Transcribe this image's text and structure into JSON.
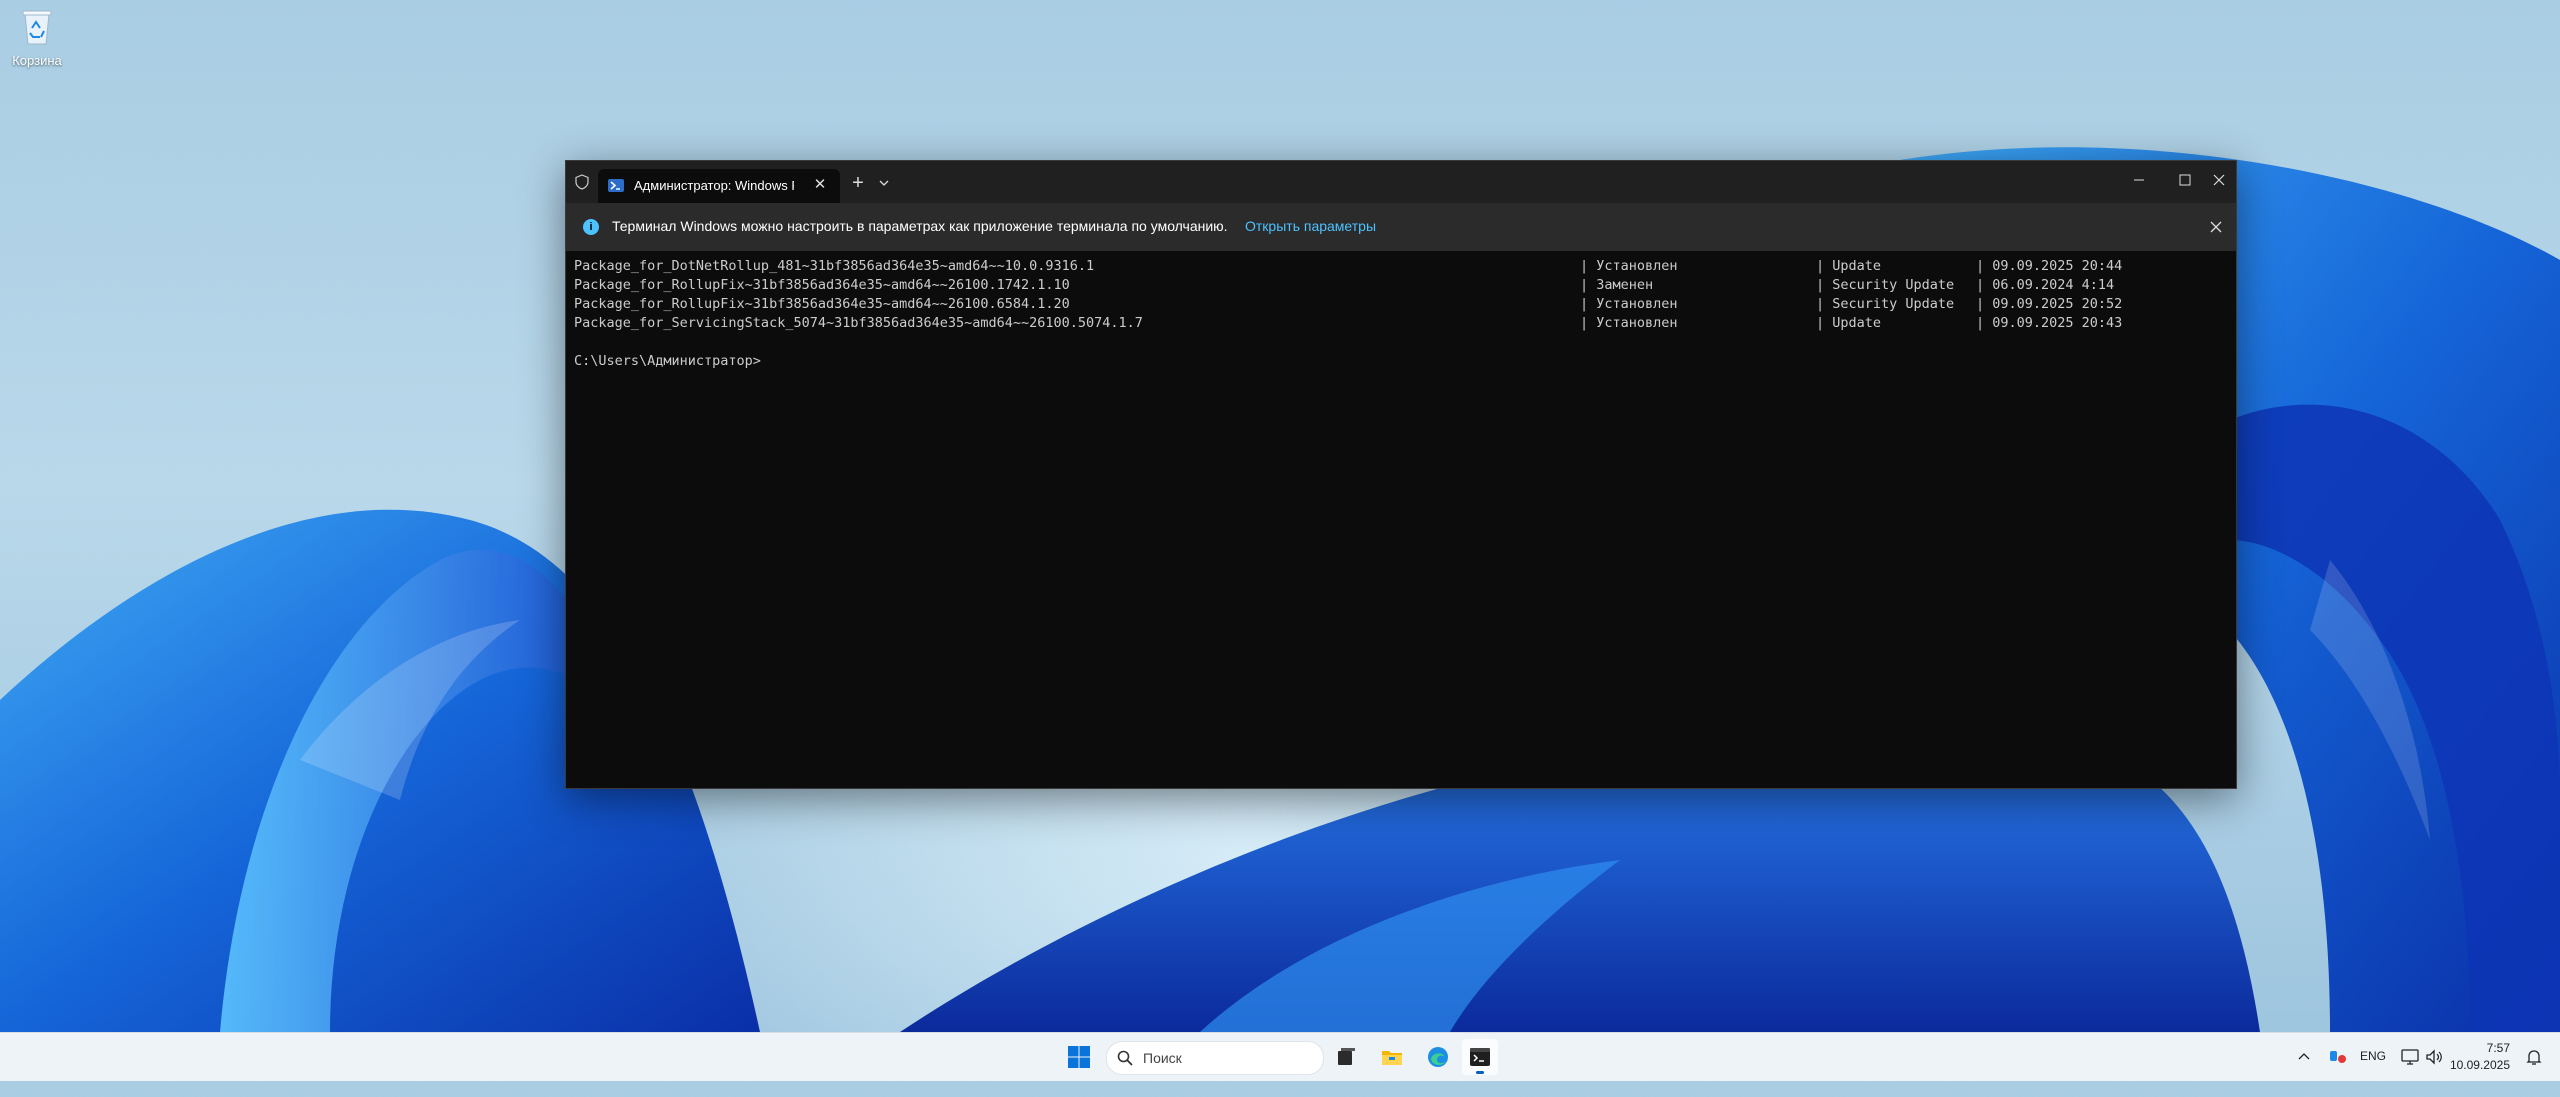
{
  "desktop": {
    "icons": [
      {
        "label": "Корзина",
        "icon": "recycle-bin-icon"
      }
    ]
  },
  "terminal": {
    "tab_title": "Администратор: Windows Po",
    "infobar": {
      "message": "Терминал Windows можно настроить в параметрах как приложение терминала по умолчанию.",
      "link": "Открыть параметры"
    },
    "rows": [
      {
        "package": "Package_for_DotNetRollup_481~31bf3856ad364e35~amd64~~10.0.9316.1",
        "state": "| Установлен",
        "type": "| Update",
        "date": "| 09.09.2025 20:44"
      },
      {
        "package": "Package_for_RollupFix~31bf3856ad364e35~amd64~~26100.1742.1.10",
        "state": "| Заменен",
        "type": "| Security Update",
        "date": "| 06.09.2024 4:14"
      },
      {
        "package": "Package_for_RollupFix~31bf3856ad364e35~amd64~~26100.6584.1.20",
        "state": "| Установлен",
        "type": "| Security Update",
        "date": "| 09.09.2025 20:52"
      },
      {
        "package": "Package_for_ServicingStack_5074~31bf3856ad364e35~amd64~~26100.5074.1.7",
        "state": "| Установлен",
        "type": "| Update",
        "date": "| 09.09.2025 20:43"
      }
    ],
    "prompt": "C:\\Users\\Администратор>"
  },
  "taskbar": {
    "search_placeholder": "Поиск",
    "apps": [
      "start-icon",
      "task-view-icon",
      "file-explorer-icon",
      "edge-icon",
      "terminal-icon"
    ],
    "language": "ENG",
    "time": "7:57",
    "date": "10.09.2025"
  },
  "colors": {
    "terminal_bg": "#0c0c0c",
    "titlebar_bg": "#202020",
    "infobar_bg": "#2b2b2b",
    "link": "#4cc2ff",
    "taskbar_bg": "#eef3f8"
  }
}
